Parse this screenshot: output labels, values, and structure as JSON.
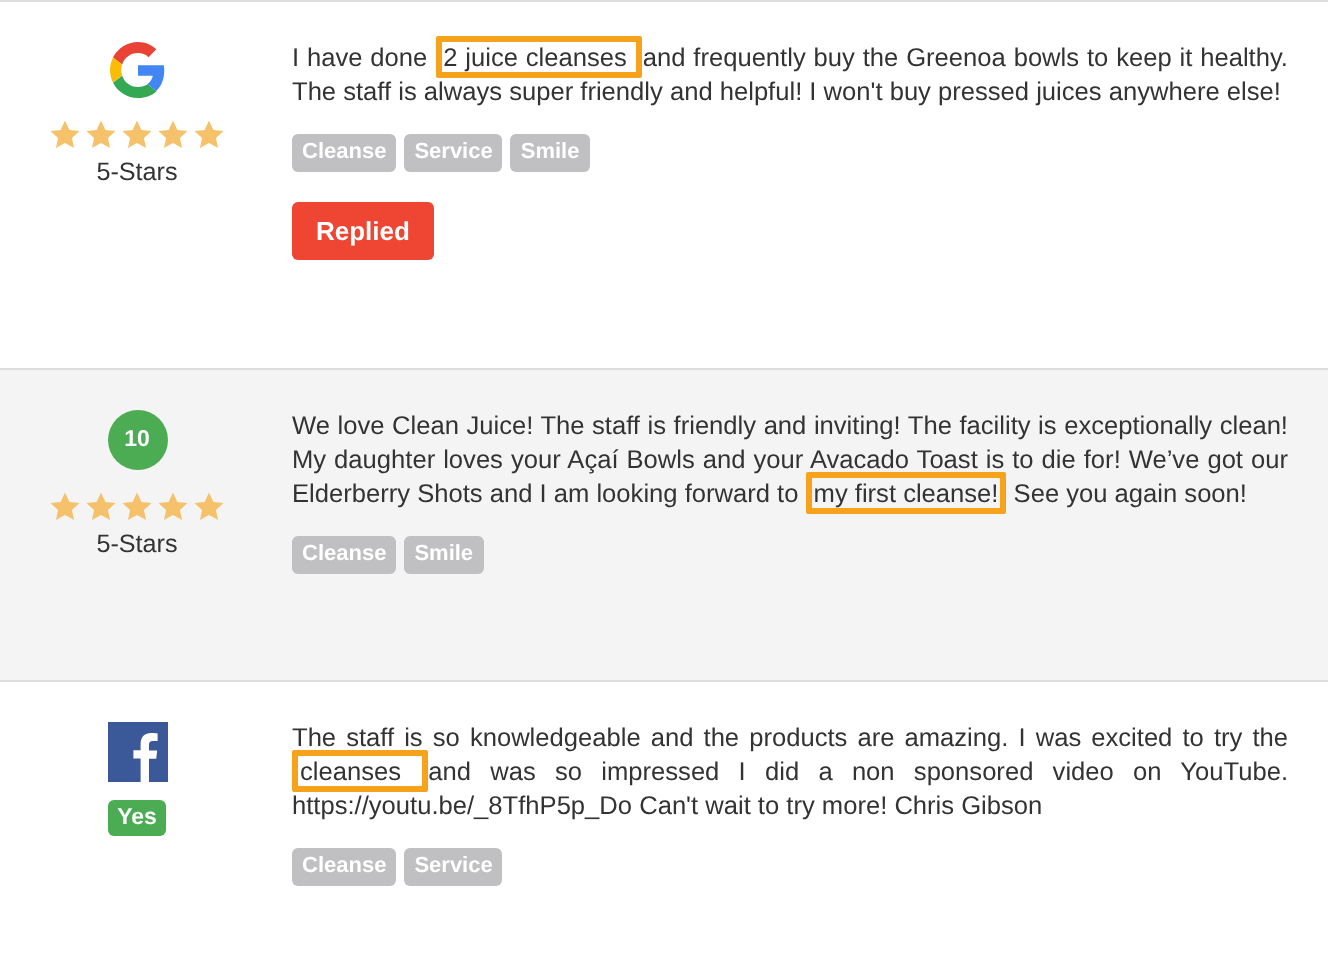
{
  "reviews": [
    {
      "kind": "google",
      "stars": 5,
      "rating_label": "5-Stars",
      "segments": [
        {
          "text": "I have done ",
          "highlighted": false
        },
        {
          "text": "2 juice cleanses ",
          "highlighted": true
        },
        {
          "text": "and frequently buy the Greenoa bowls to keep it healthy. The staff is always super friendly and helpful! I won't buy pressed juices anywhere else!",
          "highlighted": false
        }
      ],
      "tags": [
        "Cleanse",
        "Service",
        "Smile"
      ],
      "button": "Replied"
    },
    {
      "kind": "score",
      "badge": "10",
      "stars": 5,
      "rating_label": "5-Stars",
      "segments": [
        {
          "text": "We love Clean Juice! The staff is friendly and inviting! The facility is exceptionally clean! My daughter loves your Açaí Bowls and your Avacado Toast is to die for! We’ve got our Elderberry Shots and I am looking forward to ",
          "highlighted": false
        },
        {
          "text": "my first cleanse!",
          "highlighted": true
        },
        {
          "text": " See you again soon!",
          "highlighted": false
        }
      ],
      "tags": [
        "Cleanse",
        "Smile"
      ]
    },
    {
      "kind": "facebook",
      "badge": "Yes",
      "segments": [
        {
          "text": "The staff is so knowledgeable and the products are amazing. I was excited to try the ",
          "highlighted": false
        },
        {
          "text": "cleanses ",
          "highlighted": true
        },
        {
          "text": "and was so impressed I did a non sponsored video on YouTube. https://youtu.be/_8TfhP5p_Do Can't wait to try more! Chris Gibson",
          "highlighted": false
        }
      ],
      "tags": [
        "Cleanse",
        "Service"
      ]
    }
  ]
}
